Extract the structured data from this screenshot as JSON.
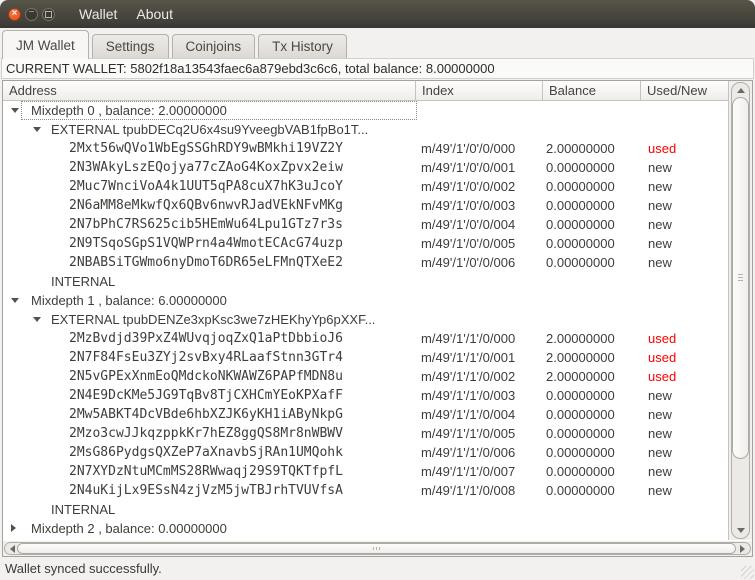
{
  "window": {
    "menus": [
      {
        "label": "Wallet"
      },
      {
        "label": "About"
      }
    ],
    "buttons": {
      "close": "×",
      "minimize": "−",
      "maximize": ""
    }
  },
  "tabs": [
    {
      "label": "JM Wallet",
      "active": true
    },
    {
      "label": "Settings",
      "active": false
    },
    {
      "label": "Coinjoins",
      "active": false
    },
    {
      "label": "Tx History",
      "active": false
    }
  ],
  "banner": {
    "text": "CURRENT WALLET: 5802f18a13543faec6a879ebd3c6c6, total balance: 8.00000000"
  },
  "table": {
    "columns": [
      "Address",
      "Index",
      "Balance",
      "Used/New"
    ],
    "rows": [
      {
        "kind": "group",
        "level": 0,
        "state": "expanded",
        "focused": true,
        "label": "Mixdepth 0 , balance: 2.00000000"
      },
      {
        "kind": "group",
        "level": 1,
        "state": "expanded",
        "label": "EXTERNAL tpubDECq2U6x4su9YveegbVAB1fpBo1T..."
      },
      {
        "kind": "address",
        "address": "2Mxt56wQVo1WbEgSSGhRDY9wBMkhi19VZ2Y",
        "index": "m/49'/1'/0'/0/000",
        "balance": "2.00000000",
        "status": "used"
      },
      {
        "kind": "address",
        "address": "2N3WAkyLszEQojya77cZAoG4KoxZpvx2eiw",
        "index": "m/49'/1'/0'/0/001",
        "balance": "0.00000000",
        "status": "new"
      },
      {
        "kind": "address",
        "address": "2Muc7WnciVoA4k1UUT5qPA8cuX7hK3uJcoY",
        "index": "m/49'/1'/0'/0/002",
        "balance": "0.00000000",
        "status": "new"
      },
      {
        "kind": "address",
        "address": "2N6aMM8eMkwfQx6QBv6nwvRJadVEkNFvMKg",
        "index": "m/49'/1'/0'/0/003",
        "balance": "0.00000000",
        "status": "new"
      },
      {
        "kind": "address",
        "address": "2N7bPhC7RS625cib5HEmWu64Lpu1GTz7r3s",
        "index": "m/49'/1'/0'/0/004",
        "balance": "0.00000000",
        "status": "new"
      },
      {
        "kind": "address",
        "address": "2N9TSqoSGpS1VQWPrn4a4WmotECAcG74uzp",
        "index": "m/49'/1'/0'/0/005",
        "balance": "0.00000000",
        "status": "new"
      },
      {
        "kind": "address",
        "address": "2NBABSiTGWmo6nyDmoT6DR65eLFMnQTXeE2",
        "index": "m/49'/1'/0'/0/006",
        "balance": "0.00000000",
        "status": "new"
      },
      {
        "kind": "group",
        "level": 1,
        "state": "none",
        "label": "INTERNAL"
      },
      {
        "kind": "group",
        "level": 0,
        "state": "expanded",
        "label": "Mixdepth 1 , balance: 6.00000000"
      },
      {
        "kind": "group",
        "level": 1,
        "state": "expanded",
        "label": "EXTERNAL tpubDENZe3xpKsc3we7zHEKhyYp6pXXF..."
      },
      {
        "kind": "address",
        "address": "2MzBvdjd39PxZ4WUvqjoqZxQ1aPtDbbioJ6",
        "index": "m/49'/1'/1'/0/000",
        "balance": "2.00000000",
        "status": "used"
      },
      {
        "kind": "address",
        "address": "2N7F84FsEu3ZYj2svBxy4RLaafStnn3GTr4",
        "index": "m/49'/1'/1'/0/001",
        "balance": "2.00000000",
        "status": "used"
      },
      {
        "kind": "address",
        "address": "2N5vGPExXnmEoQMdckoNKWAWZ6PAPfMDN8u",
        "index": "m/49'/1'/1'/0/002",
        "balance": "2.00000000",
        "status": "used"
      },
      {
        "kind": "address",
        "address": "2N4E9DcKMe5JG9TqBv8TjCXHCmYEoKPXafF",
        "index": "m/49'/1'/1'/0/003",
        "balance": "0.00000000",
        "status": "new"
      },
      {
        "kind": "address",
        "address": "2Mw5ABKT4DcVBde6hbXZJK6yKH1iAByNkpG",
        "index": "m/49'/1'/1'/0/004",
        "balance": "0.00000000",
        "status": "new"
      },
      {
        "kind": "address",
        "address": "2Mzo3cwJJkqzppkKr7hEZ8ggQS8Mr8nWBWV",
        "index": "m/49'/1'/1'/0/005",
        "balance": "0.00000000",
        "status": "new"
      },
      {
        "kind": "address",
        "address": "2MsG86PydgsQXZeP7aXnavbSjRAn1UMQohk",
        "index": "m/49'/1'/1'/0/006",
        "balance": "0.00000000",
        "status": "new"
      },
      {
        "kind": "address",
        "address": "2N7XYDzNtuMCmMS28RWwaqj29S9TQKTfpfL",
        "index": "m/49'/1'/1'/0/007",
        "balance": "0.00000000",
        "status": "new"
      },
      {
        "kind": "address",
        "address": "2N4uKijLx9ESsN4zjVzM5jwTBJrhTVUVfsA",
        "index": "m/49'/1'/1'/0/008",
        "balance": "0.00000000",
        "status": "new"
      },
      {
        "kind": "group",
        "level": 1,
        "state": "none",
        "label": "INTERNAL"
      },
      {
        "kind": "group",
        "level": 0,
        "state": "collapsed",
        "label": "Mixdepth 2 , balance: 0.00000000"
      }
    ]
  },
  "status_bar": {
    "text": "Wallet synced successfully."
  },
  "colors": {
    "used_status": "#ff0000",
    "new_status": "#3e3d3a",
    "close_button": "#e75a26",
    "titlebar": "#413f39",
    "window_background": "#f2f1f0"
  }
}
